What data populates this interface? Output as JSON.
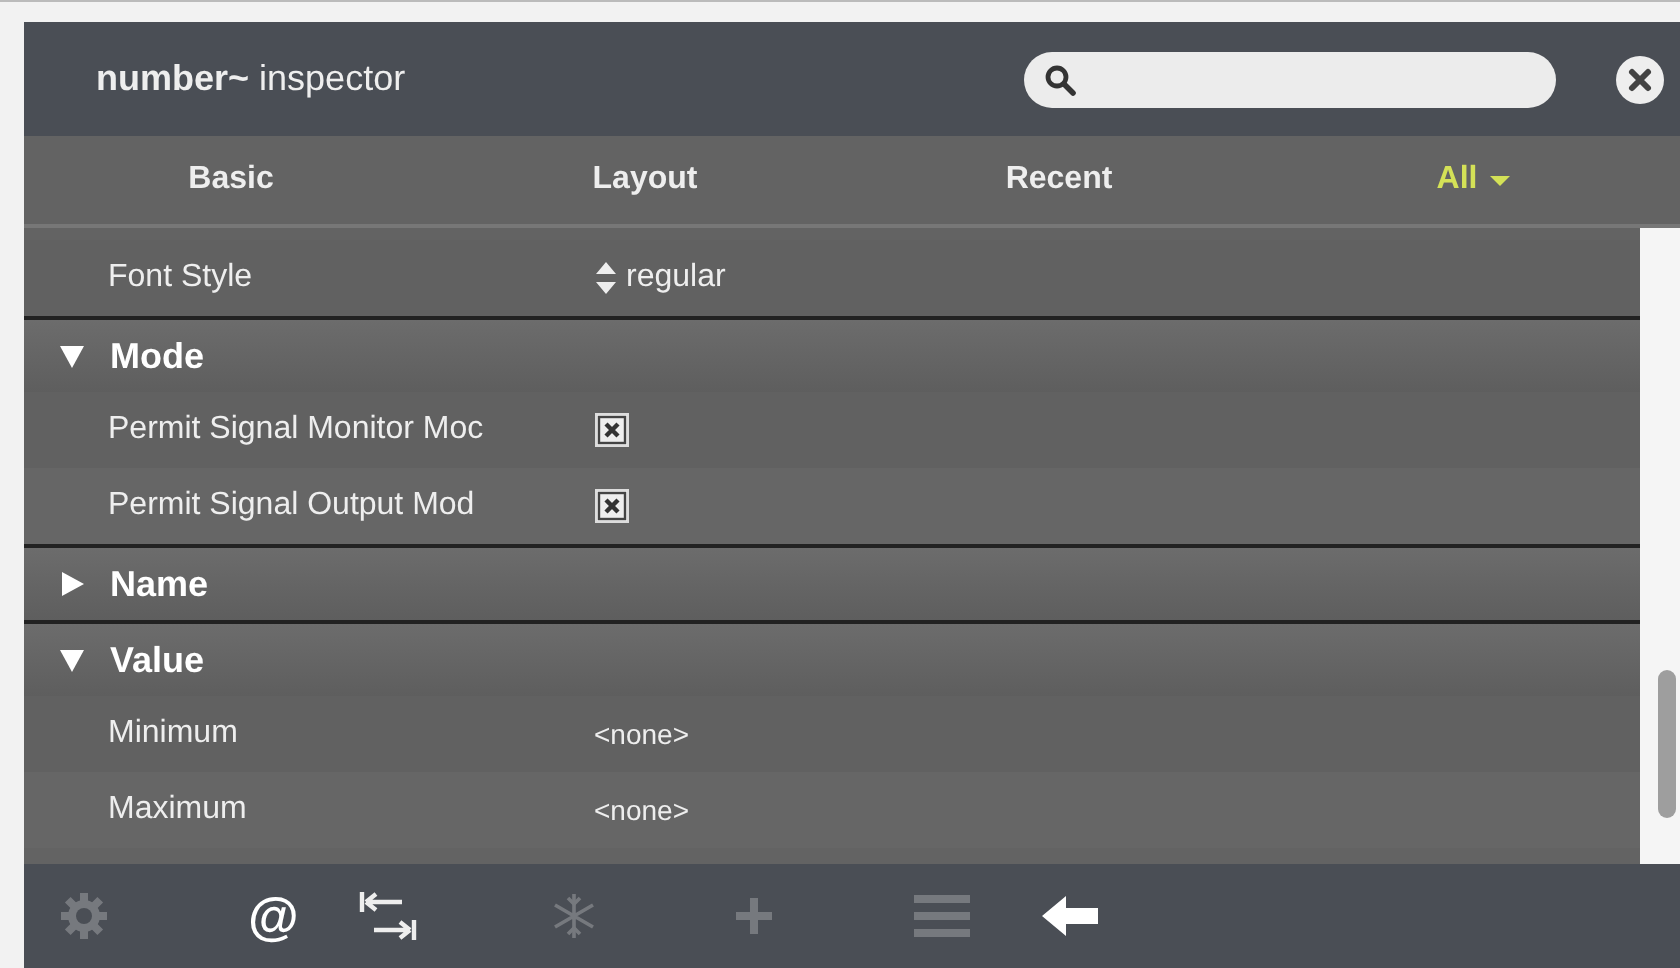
{
  "window": {
    "title_bold": "number~",
    "title": "inspector"
  },
  "tabs": [
    {
      "label": "Basic",
      "selected": false
    },
    {
      "label": "Layout",
      "selected": false
    },
    {
      "label": "Recent",
      "selected": false
    },
    {
      "label": "All",
      "selected": true
    }
  ],
  "rows": [
    {
      "kind": "property",
      "label": "Font Style",
      "control": {
        "kind": "enum",
        "value": "regular"
      }
    },
    {
      "kind": "section",
      "label": "Mode",
      "expanded": true
    },
    {
      "kind": "property",
      "label": "Permit Signal Monitor Moc",
      "control": {
        "kind": "checkbox",
        "checked": true
      }
    },
    {
      "kind": "property",
      "label": "Permit Signal Output Mod",
      "control": {
        "kind": "checkbox",
        "checked": true
      }
    },
    {
      "kind": "section",
      "label": "Name",
      "expanded": false
    },
    {
      "kind": "section",
      "label": "Value",
      "expanded": true
    },
    {
      "kind": "property",
      "label": "Minimum",
      "control": {
        "kind": "text",
        "value": "<none>"
      }
    },
    {
      "kind": "property",
      "label": "Maximum",
      "control": {
        "kind": "text",
        "value": "<none>"
      }
    }
  ],
  "toolbar": [
    {
      "kind": "gear",
      "disabled": true
    },
    {
      "kind": "char",
      "text": "@",
      "disabled": false
    },
    {
      "kind": "tab",
      "disabled": false
    },
    {
      "kind": "snowflake",
      "disabled": true
    },
    {
      "kind": "plus",
      "disabled": true
    },
    {
      "kind": "list",
      "disabled": true
    },
    {
      "kind": "back",
      "disabled": false
    }
  ]
}
